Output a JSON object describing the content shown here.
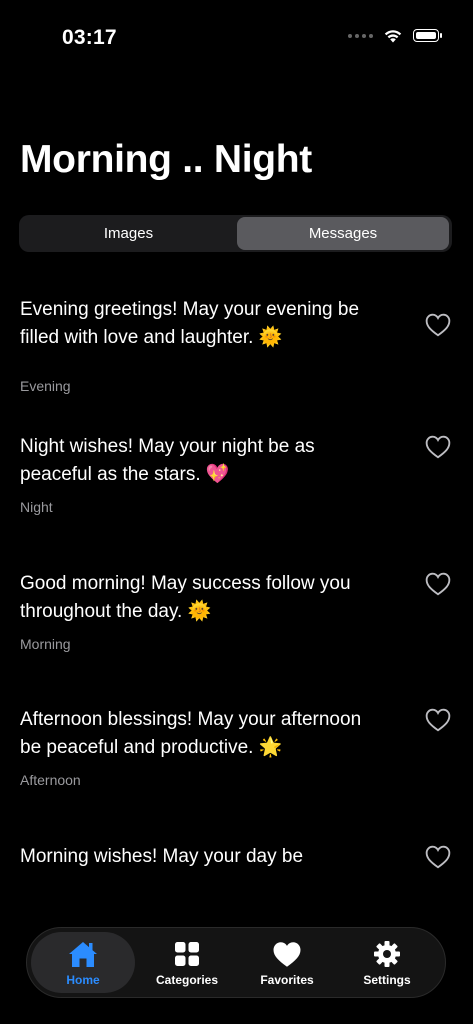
{
  "status_bar": {
    "time": "03:17"
  },
  "header": {
    "title": "Morning .. Night"
  },
  "segmented": {
    "options": [
      "Images",
      "Messages"
    ],
    "selected": "Messages"
  },
  "messages": [
    {
      "line1": "Evening greetings! May your evening be",
      "line2": "filled with love and laughter. 🌞",
      "category": "Evening",
      "favorited": false
    },
    {
      "line1": "Night wishes! May your night be as",
      "line2": "peaceful as the stars. 💖",
      "category": "Night",
      "favorited": false
    },
    {
      "line1": "Good morning! May success follow you",
      "line2": "throughout the day. 🌞",
      "category": "Morning",
      "favorited": false
    },
    {
      "line1": "Afternoon blessings! May your afternoon",
      "line2": "be peaceful and productive. 🌟",
      "category": "Afternoon",
      "favorited": false
    },
    {
      "line1": "Morning wishes! May your day be",
      "line2": "",
      "category": "",
      "favorited": false
    }
  ],
  "tab_bar": {
    "active": "Home",
    "accent_color": "#2b8cff",
    "tabs": [
      {
        "label": "Home",
        "icon": "house-icon"
      },
      {
        "label": "Categories",
        "icon": "grid-icon"
      },
      {
        "label": "Favorites",
        "icon": "heart-icon"
      },
      {
        "label": "Settings",
        "icon": "gear-icon"
      }
    ]
  }
}
